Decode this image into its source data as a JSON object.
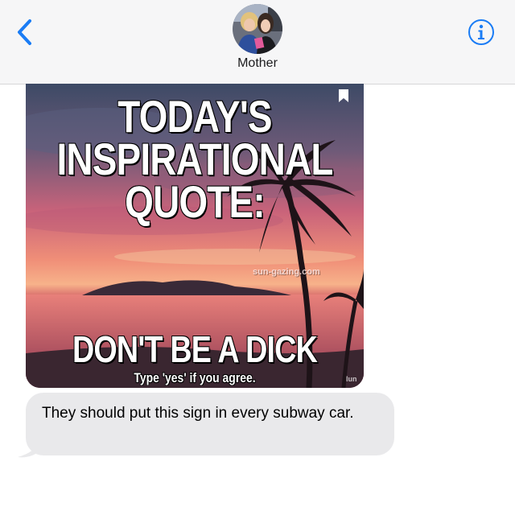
{
  "header": {
    "contact_name": "Mother",
    "back_icon": "chevron-left-icon",
    "info_icon": "info-icon",
    "accent_color": "#1a7cf5"
  },
  "messages": [
    {
      "type": "image",
      "direction": "incoming",
      "image": {
        "title_lines": [
          "TODAY'S",
          "INSPIRATIONAL",
          "QUOTE:"
        ],
        "punchline": "DON'T BE A DICK",
        "subtext": "Type 'yes' if you agree.",
        "watermark": "sun-gazing.com",
        "corner_mark": "lun",
        "bookmark_icon": "bookmark-icon"
      }
    },
    {
      "type": "text",
      "direction": "incoming",
      "text": "They should put this sign in every subway car.",
      "bubble_color": "#e9e9eb"
    }
  ]
}
